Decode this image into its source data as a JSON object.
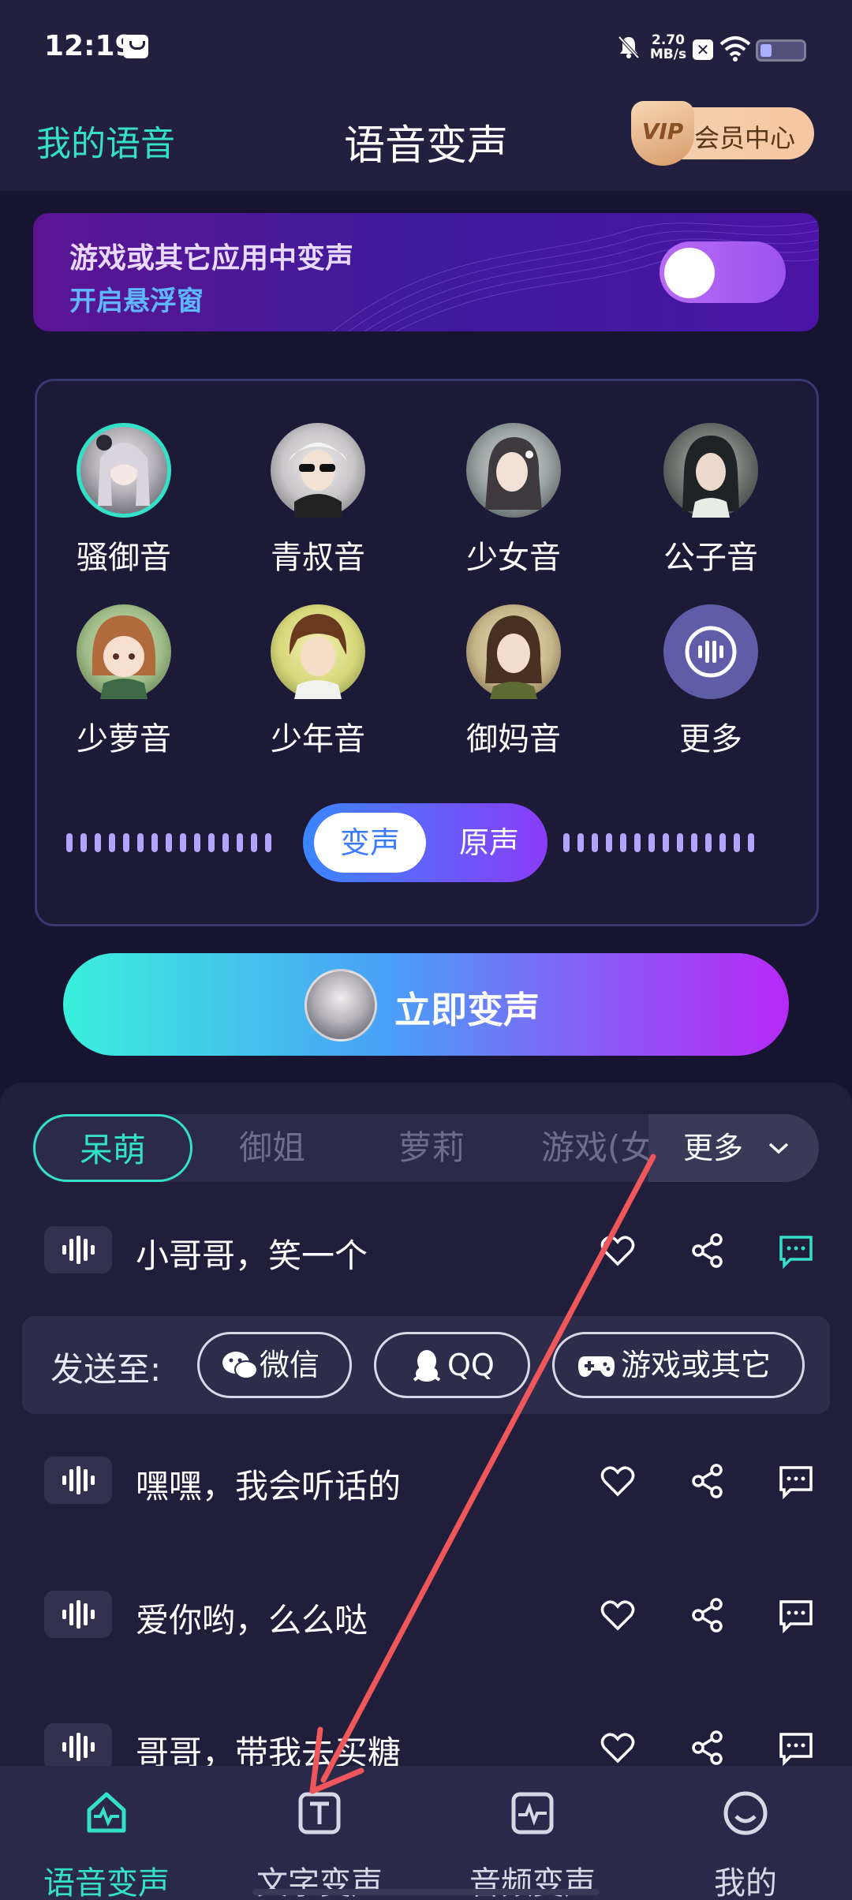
{
  "status": {
    "time": "12:19",
    "speed_value": "2.70",
    "speed_unit": "MB/s"
  },
  "header": {
    "left_link": "我的语音",
    "title": "语音变声",
    "vip_badge": "VIP",
    "vip_label": "会员中心"
  },
  "banner": {
    "title": "游戏或其它应用中变声",
    "subtitle": "开启悬浮窗",
    "toggle_on": true
  },
  "voices": [
    {
      "label": "骚御音",
      "selected": true
    },
    {
      "label": "青叔音"
    },
    {
      "label": "少女音"
    },
    {
      "label": "公子音"
    },
    {
      "label": "少萝音"
    },
    {
      "label": "少年音"
    },
    {
      "label": "御妈音"
    },
    {
      "label": "更多"
    }
  ],
  "mode_switch": {
    "active": "变声",
    "inactive": "原声"
  },
  "cta": {
    "label": "立即变声"
  },
  "tabs": {
    "items": [
      "呆萌",
      "御姐",
      "萝莉",
      "游戏(女"
    ],
    "active_index": 0,
    "more": "更多"
  },
  "phrases": [
    {
      "text": "小哥哥，笑一个"
    },
    {
      "text": "嘿嘿，我会听话的"
    },
    {
      "text": "爱你哟，么么哒"
    },
    {
      "text": "哥哥，带我去买糖"
    }
  ],
  "send_to": {
    "label": "发送至:",
    "wechat": "微信",
    "qq": "QQ",
    "game": "游戏或其它"
  },
  "nav": {
    "items": [
      "语音变声",
      "文字变声",
      "音频变声",
      "我的"
    ],
    "active_index": 0
  },
  "colors": {
    "accent": "#35e0c9",
    "background": "#161431",
    "annotation_arrow": "#f0575a"
  }
}
